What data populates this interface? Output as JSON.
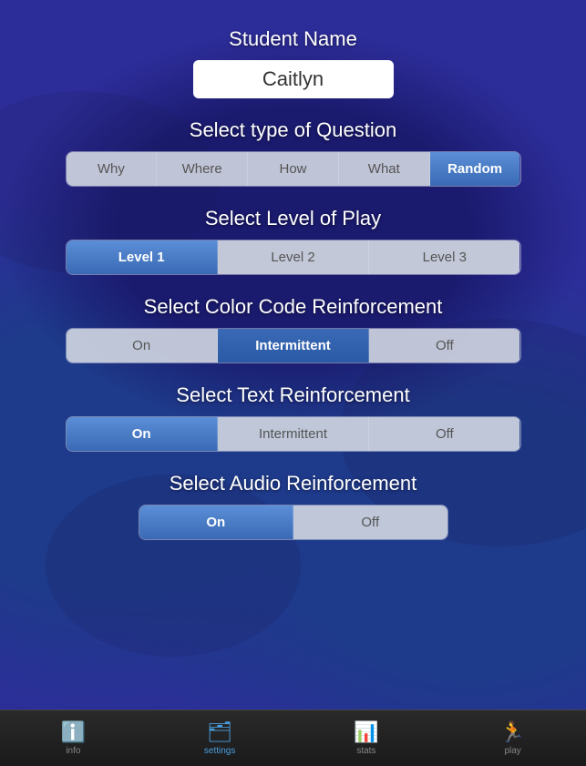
{
  "header": {
    "student_name_label": "Student Name",
    "student_name_value": "Caitlyn"
  },
  "question_type": {
    "label": "Select type of Question",
    "options": [
      "Why",
      "Where",
      "How",
      "What",
      "Random"
    ],
    "active": "Random"
  },
  "level_of_play": {
    "label": "Select Level of Play",
    "options": [
      "Level 1",
      "Level 2",
      "Level 3"
    ],
    "active": "Level 1"
  },
  "color_code": {
    "label": "Select Color Code Reinforcement",
    "options": [
      "On",
      "Intermittent",
      "Off"
    ],
    "active": "Intermittent"
  },
  "text_reinforcement": {
    "label": "Select Text Reinforcement",
    "options": [
      "On",
      "Intermittent",
      "Off"
    ],
    "active": "On"
  },
  "audio_reinforcement": {
    "label": "Select Audio Reinforcement",
    "options": [
      "On",
      "Off"
    ],
    "active": "On"
  },
  "tab_bar": {
    "items": [
      {
        "label": "info",
        "icon": "ℹ"
      },
      {
        "label": "settings",
        "icon": "📋"
      },
      {
        "label": "stats",
        "icon": "📊"
      },
      {
        "label": "play",
        "icon": "🏃"
      }
    ],
    "active": "settings"
  }
}
